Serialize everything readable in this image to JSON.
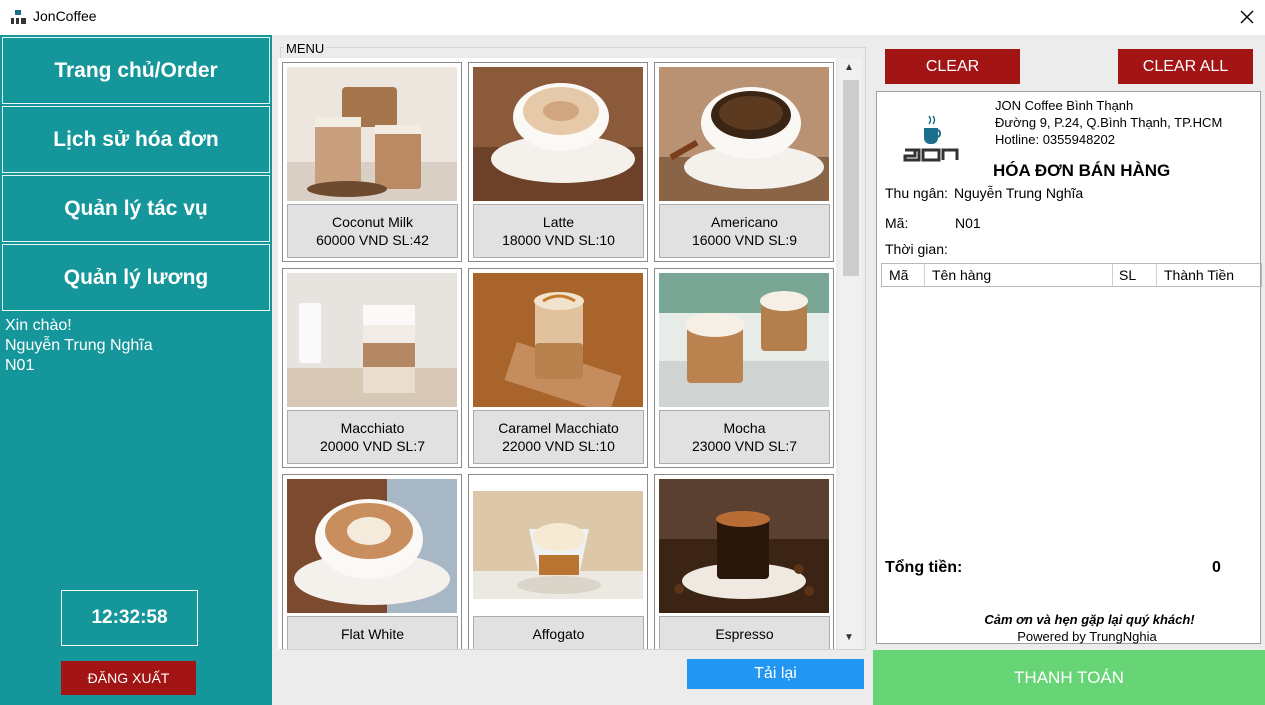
{
  "window": {
    "title": "JonCoffee"
  },
  "sidebar": {
    "nav": [
      "Trang chủ/Order",
      "Lịch sử hóa đơn",
      "Quản lý tác vụ",
      "Quản lý lương"
    ],
    "greeting": "Xin chào!",
    "user_name": "Nguyễn Trung Nghĩa",
    "user_code": "N01",
    "clock": "12:32:58",
    "logout": "ĐĂNG XUẤT"
  },
  "menu": {
    "legend": "MENU",
    "items": [
      {
        "name": "Coconut Milk",
        "detail": "60000 VND SL:42"
      },
      {
        "name": "Latte",
        "detail": "18000 VND SL:10"
      },
      {
        "name": "Americano",
        "detail": "16000 VND SL:9"
      },
      {
        "name": "Macchiato",
        "detail": "20000 VND SL:7"
      },
      {
        "name": "Caramel Macchiato",
        "detail": "22000 VND SL:10"
      },
      {
        "name": "Mocha",
        "detail": "23000 VND SL:7"
      },
      {
        "name": "Flat White",
        "detail": ""
      },
      {
        "name": "Affogato",
        "detail": ""
      },
      {
        "name": "Espresso",
        "detail": ""
      }
    ],
    "reload": "Tải lại"
  },
  "invoice": {
    "clear": "CLEAR",
    "clear_all": "CLEAR ALL",
    "shop": [
      "JON Coffee Bình Thạnh",
      "Đường 9, P.24, Q.Bình Thạnh, TP.HCM",
      "Hotline: 0355948202"
    ],
    "title": "HÓA ĐƠN BÁN HÀNG",
    "cashier_label": "Thu ngân:",
    "cashier": "Nguyễn Trung Nghĩa",
    "code_label": "Mã:",
    "code": "N01",
    "time_label": "Thời gian:",
    "columns": [
      "Mã",
      "Tên hàng",
      "SL",
      "Thành Tiền"
    ],
    "total_label": "Tổng tiền:",
    "total": "0",
    "thanks": "Cảm ơn và hẹn gặp lại quý khách!",
    "powered": "Powered by TrungNghia",
    "pay": "THANH TOÁN"
  },
  "colors": {
    "teal": "#14969b",
    "red": "#a31414",
    "green": "#67d475",
    "blue": "#2196f3"
  }
}
